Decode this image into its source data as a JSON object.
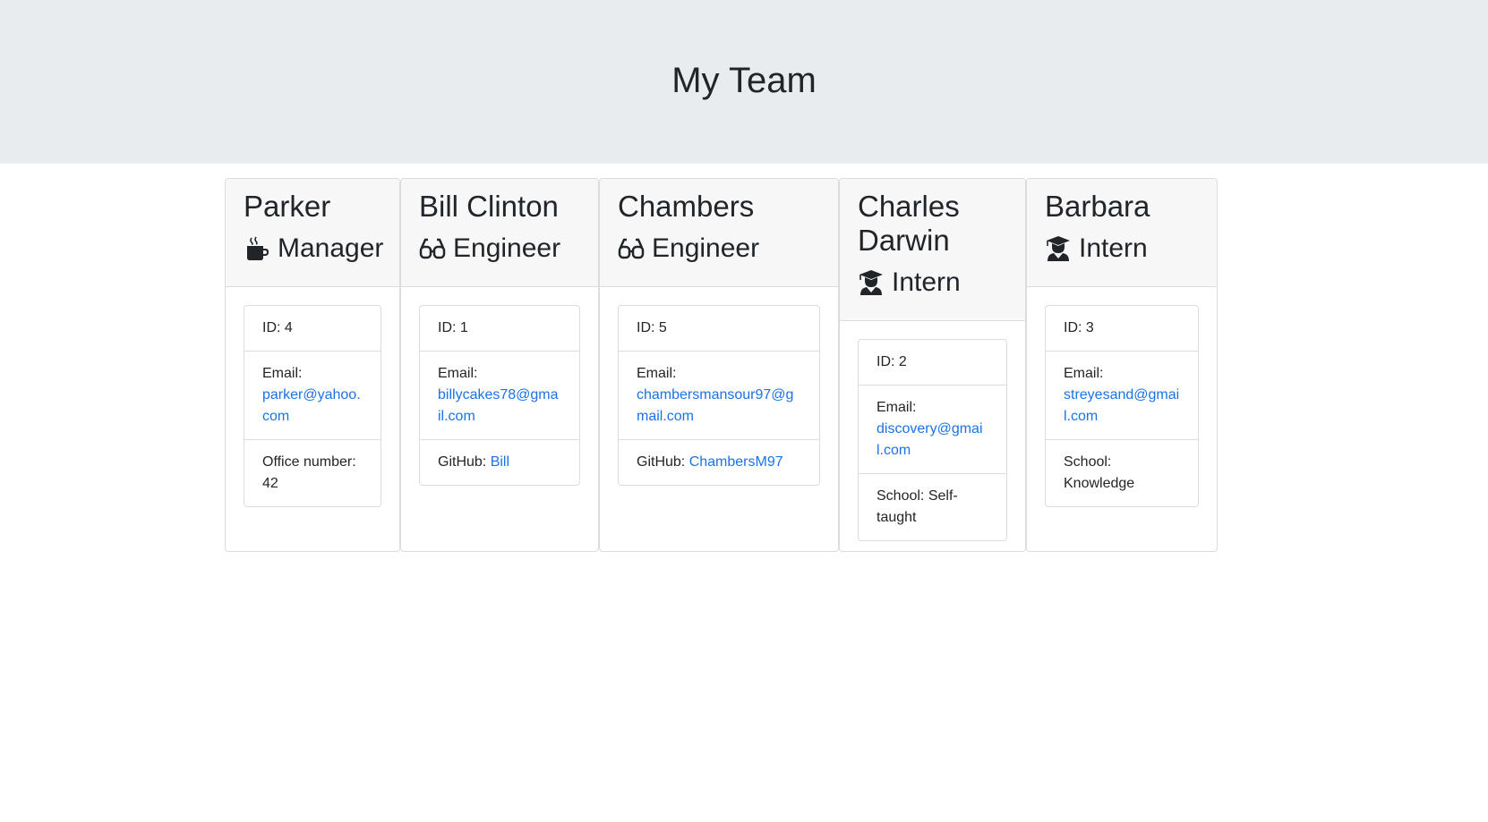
{
  "page_title": "My Team",
  "colors": {
    "link": "#1a73e8",
    "header_bg": "#e9ecef"
  },
  "team": [
    {
      "name": "Parker",
      "role": "Manager",
      "icon": "mug-icon",
      "id_line": "ID: 4",
      "email_label": "Email:",
      "email": "parker@yahoo.com",
      "extra_label": "Office number:",
      "extra_value": "42"
    },
    {
      "name": "Bill Clinton",
      "role": "Engineer",
      "icon": "glasses-icon",
      "id_line": "ID: 1",
      "email_label": "Email:",
      "email": "billycakes78@gmail.com",
      "extra_label": "GitHub:",
      "extra_value": "Bill"
    },
    {
      "name": "Chambers",
      "role": "Engineer",
      "icon": "glasses-icon",
      "id_line": "ID: 5",
      "email_label": "Email:",
      "email": "chambersmansour97@gmail.com",
      "extra_label": "GitHub:",
      "extra_value": "ChambersM97"
    },
    {
      "name": "Charles Darwin",
      "role": "Intern",
      "icon": "graduate-icon",
      "id_line": "ID: 2",
      "email_label": "Email:",
      "email": "discovery@gmail.com",
      "extra_label": "School:",
      "extra_value": "Self-taught"
    },
    {
      "name": "Barbara",
      "role": "Intern",
      "icon": "graduate-icon",
      "id_line": "ID: 3",
      "email_label": "Email:",
      "email": "streyesand@gmail.com",
      "extra_label": "School:",
      "extra_value": "Knowledge"
    }
  ]
}
